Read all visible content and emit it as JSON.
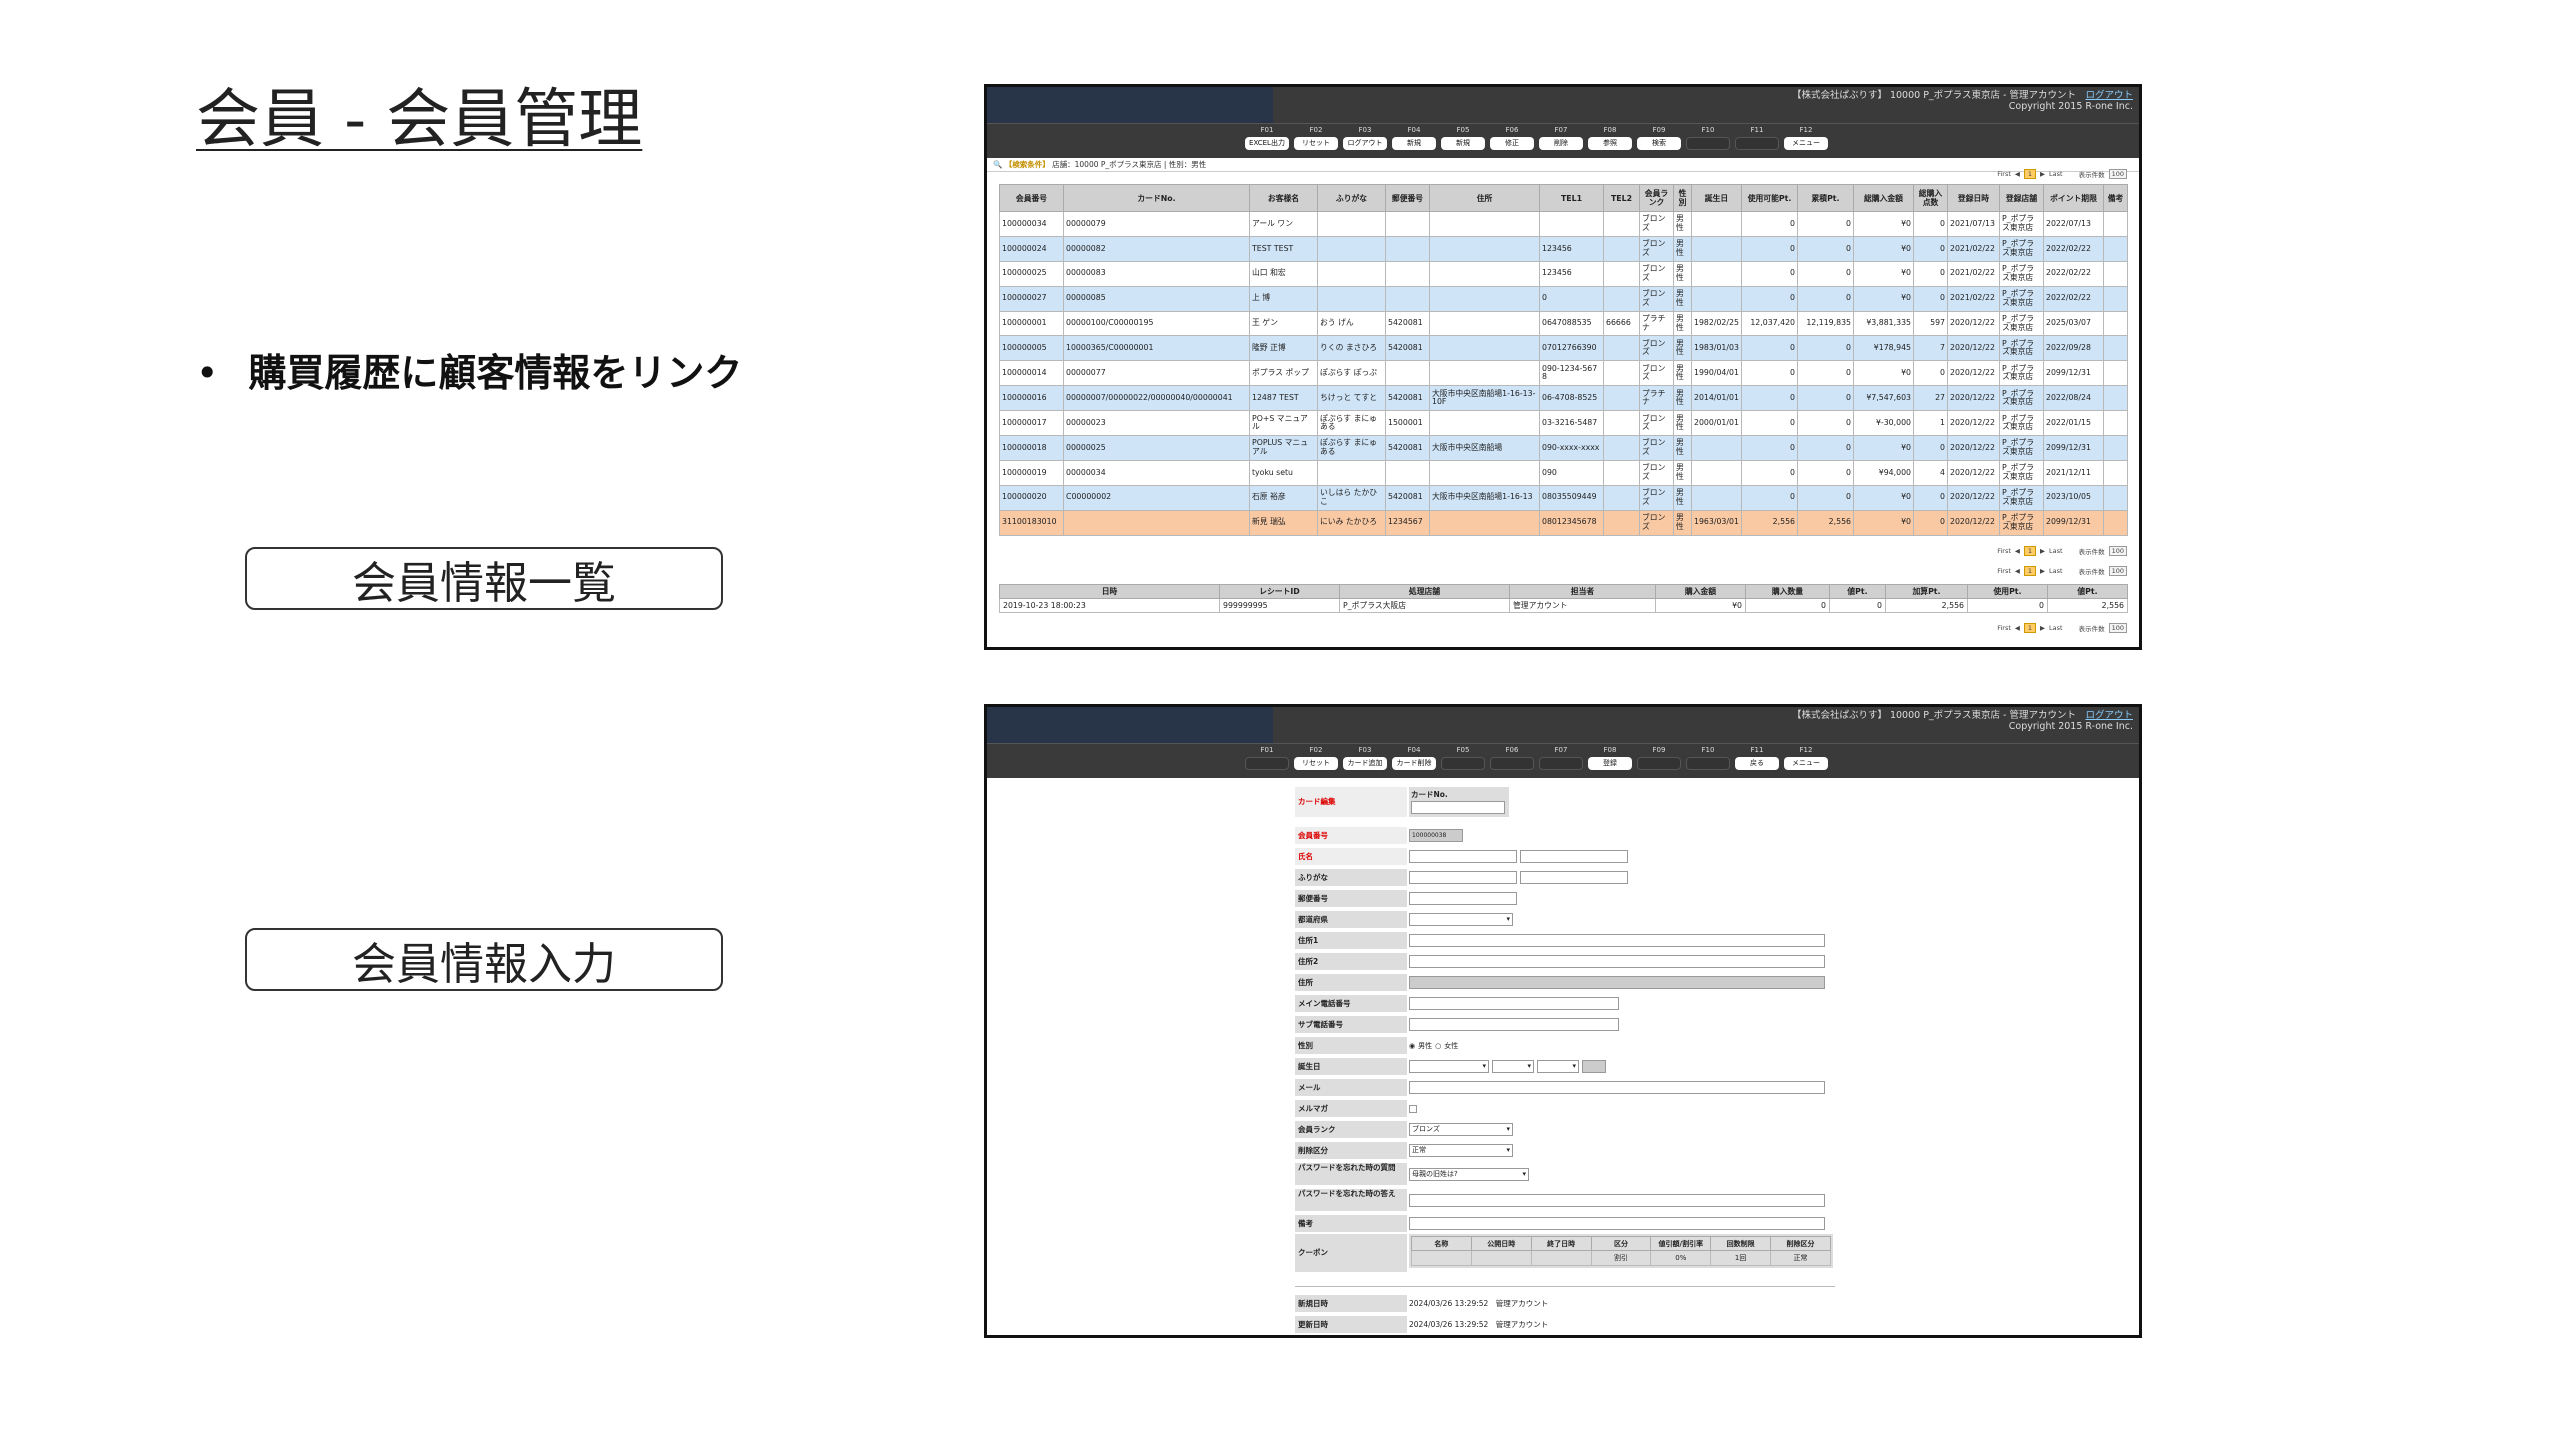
{
  "slide": {
    "title": "会員 - 会員管理",
    "bullet": "購買履歴に顧客情報をリンク",
    "btn_list": "会員情報一覧",
    "btn_input": "会員情報入力",
    "bullet_char": "•"
  },
  "app": {
    "company_line": "【株式会社ぱぶりす】 10000 P_ポプラス東京店 - 管理アカウント",
    "logout": "ログアウト",
    "copyright": "Copyright 2015 R-one Inc."
  },
  "fkeys_list": [
    {
      "k": "F01",
      "l": "EXCEL出力"
    },
    {
      "k": "F02",
      "l": "リセット"
    },
    {
      "k": "F03",
      "l": "ログアウト"
    },
    {
      "k": "F04",
      "l": "新規"
    },
    {
      "k": "F05",
      "l": "新規"
    },
    {
      "k": "F06",
      "l": "修正"
    },
    {
      "k": "F07",
      "l": "削除"
    },
    {
      "k": "F08",
      "l": "参照"
    },
    {
      "k": "F09",
      "l": "検索"
    },
    {
      "k": "F10",
      "l": ""
    },
    {
      "k": "F11",
      "l": ""
    },
    {
      "k": "F12",
      "l": "メニュー"
    }
  ],
  "fkeys_form": [
    {
      "k": "F01",
      "l": ""
    },
    {
      "k": "F02",
      "l": "リセット"
    },
    {
      "k": "F03",
      "l": "カード追加"
    },
    {
      "k": "F04",
      "l": "カード削除"
    },
    {
      "k": "F05",
      "l": ""
    },
    {
      "k": "F06",
      "l": ""
    },
    {
      "k": "F07",
      "l": ""
    },
    {
      "k": "F08",
      "l": "登録"
    },
    {
      "k": "F09",
      "l": ""
    },
    {
      "k": "F10",
      "l": ""
    },
    {
      "k": "F11",
      "l": "戻る"
    },
    {
      "k": "F12",
      "l": "メニュー"
    }
  ],
  "cond": {
    "label": "【検索条件】",
    "text": "店舗：10000 P_ポプラス東京店 | 性別：男性"
  },
  "pager": {
    "first": "First",
    "prev": "◀",
    "page": "1",
    "next": "▶",
    "last": "Last",
    "count_label": "表示件数",
    "count": "100"
  },
  "members_headers": [
    "会員番号",
    "カードNo.",
    "お客様名",
    "ふりがな",
    "郵便番号",
    "住所",
    "TEL1",
    "TEL2",
    "会員ランク",
    "性別",
    "誕生日",
    "使用可能Pt.",
    "累積Pt.",
    "総購入金額",
    "総購入点数",
    "登録日時",
    "登録店舗",
    "ポイント期限",
    "備考"
  ],
  "members": [
    [
      "100000034",
      "00000079",
      "アール ワン",
      "",
      "",
      "",
      "",
      "",
      "ブロンズ",
      "男性",
      "",
      "0",
      "0",
      "¥0",
      "0",
      "2021/07/13",
      "P_ポプラス東京店",
      "2022/07/13",
      ""
    ],
    [
      "100000024",
      "00000082",
      "TEST TEST",
      "",
      "",
      "",
      "123456",
      "",
      "ブロンズ",
      "男性",
      "",
      "0",
      "0",
      "¥0",
      "0",
      "2021/02/22",
      "P_ポプラス東京店",
      "2022/02/22",
      ""
    ],
    [
      "100000025",
      "00000083",
      "山口 和宏",
      "",
      "",
      "",
      "123456",
      "",
      "ブロンズ",
      "男性",
      "",
      "0",
      "0",
      "¥0",
      "0",
      "2021/02/22",
      "P_ポプラス東京店",
      "2022/02/22",
      ""
    ],
    [
      "100000027",
      "00000085",
      "上 博",
      "",
      "",
      "",
      "0",
      "",
      "ブロンズ",
      "男性",
      "",
      "0",
      "0",
      "¥0",
      "0",
      "2021/02/22",
      "P_ポプラス東京店",
      "2022/02/22",
      ""
    ],
    [
      "100000001",
      "00000100/C00000195",
      "王 ゲン",
      "おう げん",
      "5420081",
      "",
      "0647088535",
      "66666",
      "プラチナ",
      "男性",
      "1982/02/25",
      "12,037,420",
      "12,119,835",
      "¥3,881,335",
      "597",
      "2020/12/22",
      "P_ポプラス東京店",
      "2025/03/07",
      ""
    ],
    [
      "100000005",
      "10000365/C00000001",
      "隆野 正博",
      "りくの まさひろ",
      "5420081",
      "",
      "07012766390",
      "",
      "ブロンズ",
      "男性",
      "1983/01/03",
      "0",
      "0",
      "¥178,945",
      "7",
      "2020/12/22",
      "P_ポプラス東京店",
      "2022/09/28",
      ""
    ],
    [
      "100000014",
      "00000077",
      "ポプラス ポップ",
      "ぽぷらす ぽっぷ",
      "",
      "",
      "090-1234-5678",
      "",
      "ブロンズ",
      "男性",
      "1990/04/01",
      "0",
      "0",
      "¥0",
      "0",
      "2020/12/22",
      "P_ポプラス東京店",
      "2099/12/31",
      ""
    ],
    [
      "100000016",
      "00000007/00000022/00000040/00000041",
      "12487 TEST",
      "ちけっと てすと",
      "5420081",
      "大阪市中央区南船場1-16-13-10F",
      "06-4708-8525",
      "",
      "プラチナ",
      "男性",
      "2014/01/01",
      "0",
      "0",
      "¥7,547,603",
      "27",
      "2020/12/22",
      "P_ポプラス東京店",
      "2022/08/24",
      ""
    ],
    [
      "100000017",
      "00000023",
      "PO+S マニュアル",
      "ぽぷらす まにゅある",
      "1500001",
      "",
      "03-3216-5487",
      "",
      "ブロンズ",
      "男性",
      "2000/01/01",
      "0",
      "0",
      "¥-30,000",
      "1",
      "2020/12/22",
      "P_ポプラス東京店",
      "2022/01/15",
      ""
    ],
    [
      "100000018",
      "00000025",
      "POPLUS マニュアル",
      "ぽぷらす まにゅある",
      "5420081",
      "大阪市中央区南船場",
      "090-xxxx-xxxx",
      "",
      "ブロンズ",
      "男性",
      "",
      "0",
      "0",
      "¥0",
      "0",
      "2020/12/22",
      "P_ポプラス東京店",
      "2099/12/31",
      ""
    ],
    [
      "100000019",
      "00000034",
      "tyoku setu",
      "",
      "",
      "",
      "090",
      "",
      "ブロンズ",
      "男性",
      "",
      "0",
      "0",
      "¥94,000",
      "4",
      "2020/12/22",
      "P_ポプラス東京店",
      "2021/12/11",
      ""
    ],
    [
      "100000020",
      "C00000002",
      "石原 裕彦",
      "いしはら たかひこ",
      "5420081",
      "大阪市中央区南船場1-16-13",
      "08035509449",
      "",
      "ブロンズ",
      "男性",
      "",
      "0",
      "0",
      "¥0",
      "0",
      "2020/12/22",
      "P_ポプラス東京店",
      "2023/10/05",
      ""
    ],
    [
      "31100183010",
      "",
      "新見 瑞弘",
      "にいみ たかひろ",
      "1234567",
      "",
      "08012345678",
      "",
      "ブロンズ",
      "男性",
      "1963/03/01",
      "2,556",
      "2,556",
      "¥0",
      "0",
      "2020/12/22",
      "P_ポプラス東京店",
      "2099/12/31",
      ""
    ]
  ],
  "purchase_headers": [
    "日時",
    "レシートID",
    "処理店舗",
    "担当者",
    "購入金額",
    "購入数量",
    "値Pt.",
    "加算Pt.",
    "使用Pt.",
    "値Pt."
  ],
  "purchases": [
    [
      "2019-10-23 18:00:23",
      "999999995",
      "P_ポプラス大阪店",
      "管理アカウント",
      "¥0",
      "0",
      "0",
      "2,556",
      "0",
      "2,556"
    ]
  ],
  "form": {
    "card_label": "カード編集",
    "card_no": "カードNo.",
    "member_no": "会員番号",
    "member_val": "100000038",
    "name": "氏名",
    "kana": "ふりがな",
    "zip": "郵便番号",
    "pref": "都道府県",
    "addr1": "住所1",
    "addr2": "住所2",
    "addr": "住所",
    "tel_main": "メイン電話番号",
    "tel_sub": "サブ電話番号",
    "gender": "性別",
    "gender_m": "男性",
    "gender_f": "女性",
    "birthday": "誕生日",
    "mail": "メール",
    "mailmag": "メルマガ",
    "rank": "会員ランク",
    "rank_val": "ブロンズ",
    "del": "削除区分",
    "del_val": "正常",
    "pwq": "パスワードを忘れた時の質問",
    "pwq_val": "母親の旧姓は?",
    "pwa": "パスワードを忘れた時の答え",
    "note": "備考",
    "coupon": "クーポン",
    "coupon_headers": [
      "名称",
      "公開日時",
      "終了日時",
      "区分",
      "値引額/割引率",
      "回数制限",
      "削除区分"
    ],
    "coupon_row": [
      "",
      "",
      "",
      "割引",
      "0%",
      "1回",
      "正常"
    ],
    "created": "新規日時",
    "created_val": "2024/03/26 13:29:52　管理アカウント",
    "updated": "更新日時",
    "updated_val": "2024/03/26 13:29:52　管理アカウント"
  }
}
